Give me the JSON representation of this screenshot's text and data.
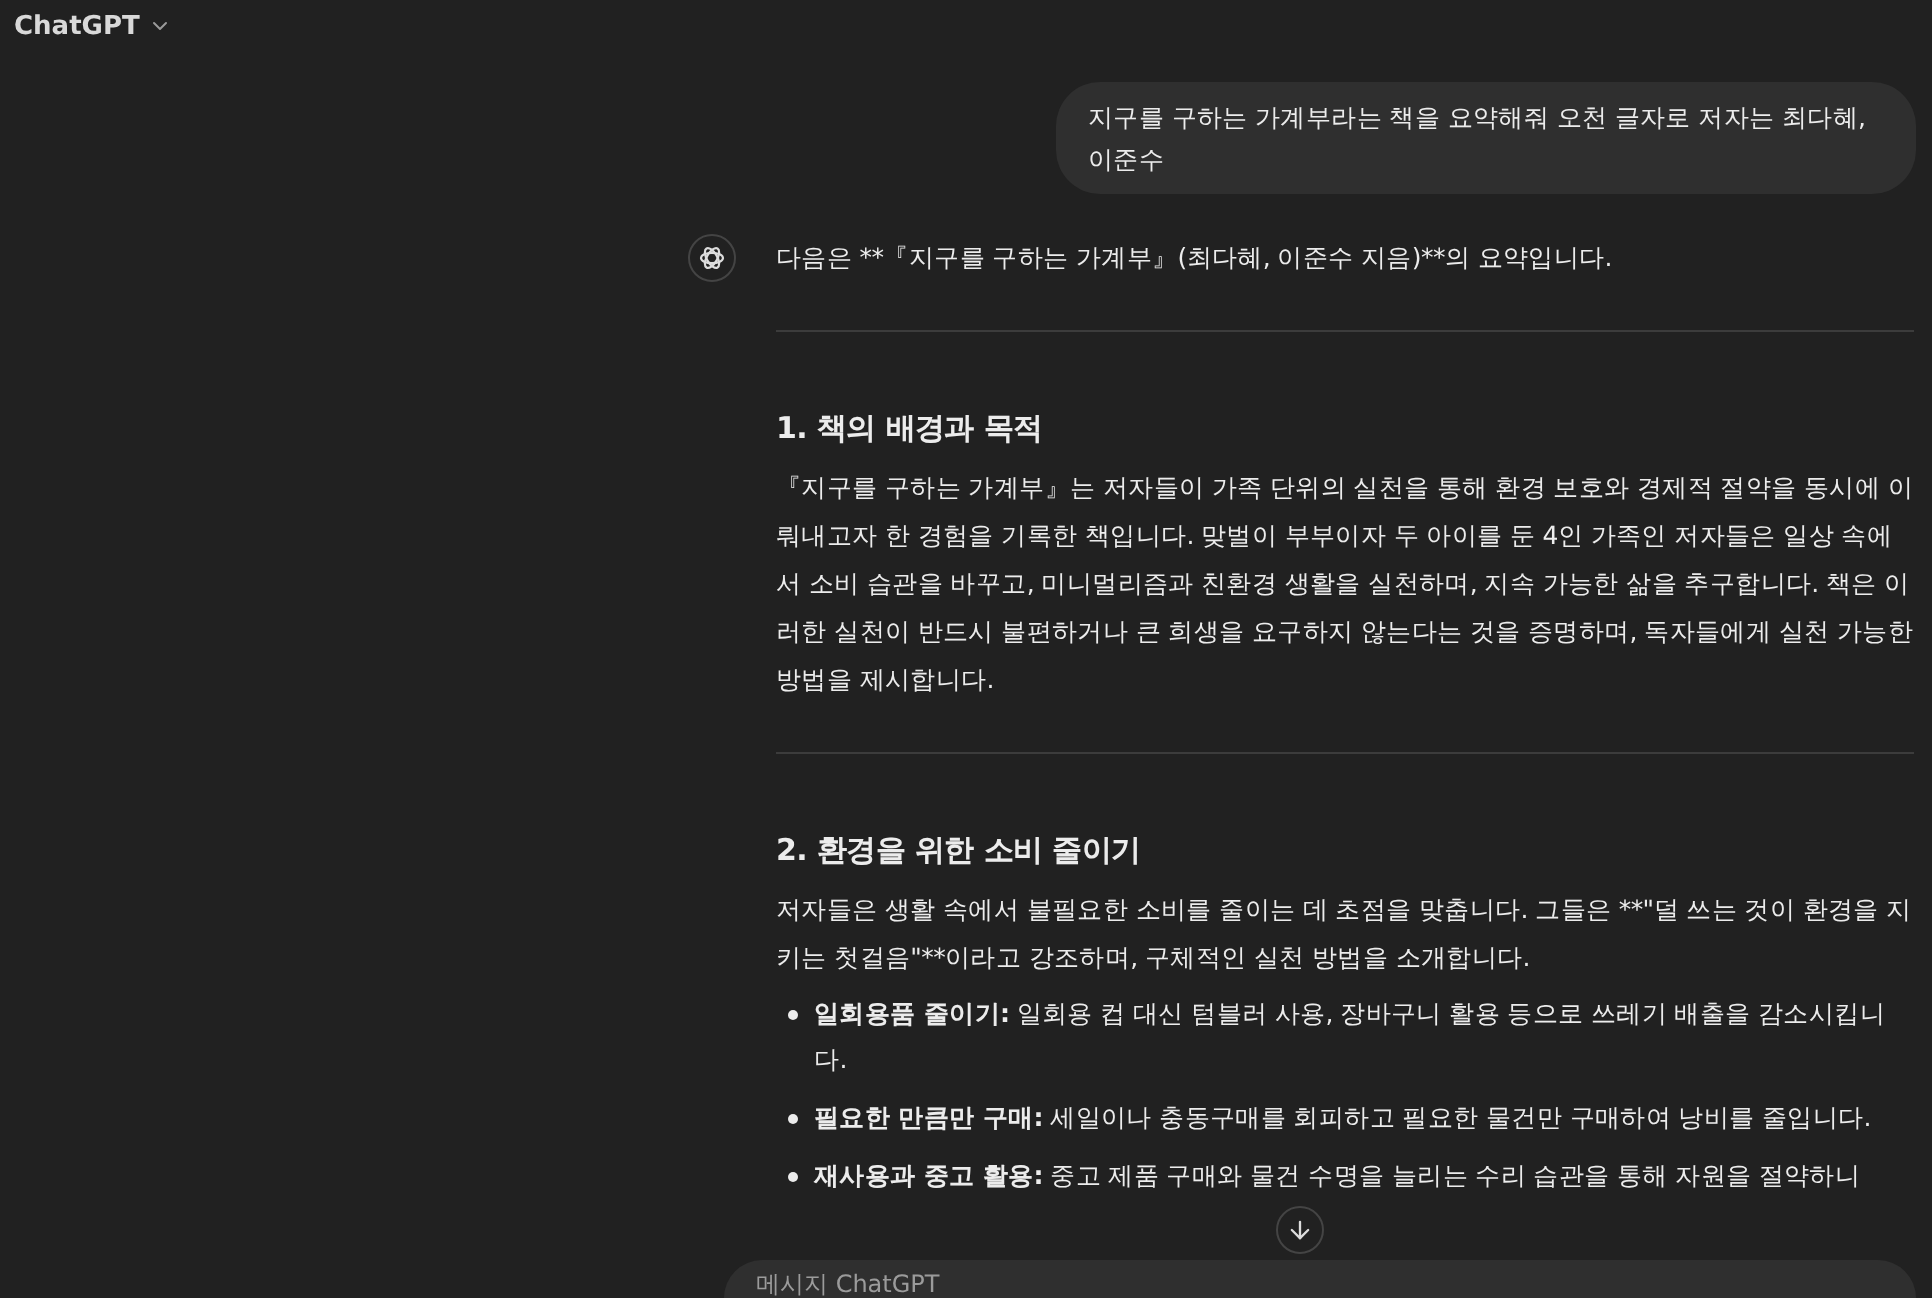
{
  "header": {
    "title": "ChatGPT"
  },
  "user_message": {
    "text": "지구를 구하는 가계부라는 책을 요약해줘 오천 글자로 저자는 최다혜, 이준수"
  },
  "assistant_message": {
    "intro": "다음은 **『지구를 구하는 가계부』(최다혜, 이준수 지음)**의 요약입니다.",
    "sections": [
      {
        "heading": "1. 책의 배경과 목적",
        "paragraph": "『지구를 구하는 가계부』는 저자들이 가족 단위의 실천을 통해 환경 보호와 경제적 절약을 동시에 이뤄내고자 한 경험을 기록한 책입니다. 맞벌이 부부이자 두 아이를 둔 4인 가족인 저자들은 일상 속에서 소비 습관을 바꾸고, 미니멀리즘과 친환경 생활을 실천하며, 지속 가능한 삶을 추구합니다. 책은 이러한 실천이 반드시 불편하거나 큰 희생을 요구하지 않는다는 것을 증명하며, 독자들에게 실천 가능한 방법을 제시합니다."
      },
      {
        "heading": "2. 환경을 위한 소비 줄이기",
        "paragraph": "저자들은 생활 속에서 불필요한 소비를 줄이는 데 초점을 맞춥니다. 그들은 **\"덜 쓰는 것이 환경을 지키는 첫걸음\"**이라고 강조하며, 구체적인 실천 방법을 소개합니다.",
        "bullets": [
          {
            "term": "일회용품 줄이기:",
            "text": "일회용 컵 대신 텀블러 사용, 장바구니 활용 등으로 쓰레기 배출을 감소시킵니다."
          },
          {
            "term": "필요한 만큼만 구매:",
            "text": "세일이나 충동구매를 회피하고 필요한 물건만 구매하여 낭비를 줄입니다."
          },
          {
            "term": "재사용과 중고 활용:",
            "text": "중고 제품 구매와 물건 수명을 늘리는 수리 습관을 통해 자원을 절약하니"
          }
        ]
      }
    ]
  },
  "composer": {
    "placeholder": "메시지 ChatGPT"
  }
}
